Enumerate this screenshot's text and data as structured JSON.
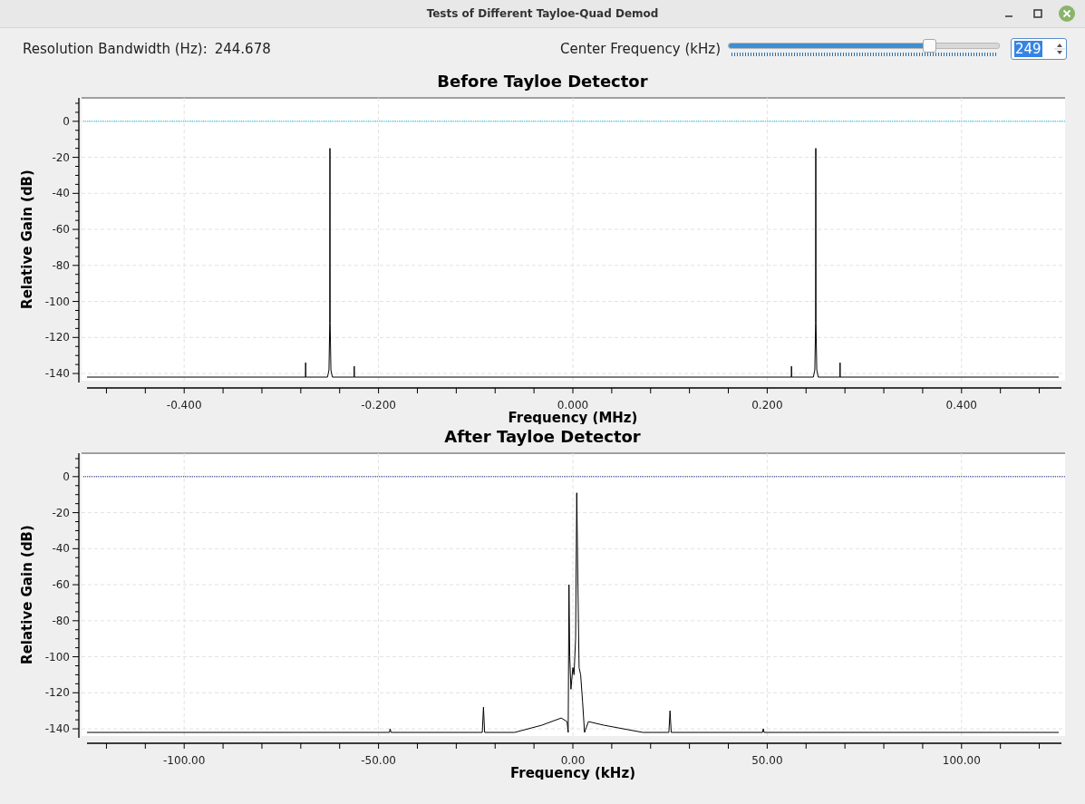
{
  "window": {
    "title": "Tests of Different Tayloe-Quad Demod"
  },
  "controls": {
    "resolution_label": "Resolution Bandwidth (Hz):",
    "resolution_value": "244.678",
    "center_label": "Center Frequency (kHz)",
    "center_slider": {
      "level": 0.74
    },
    "center_spinbox": {
      "value": "249"
    }
  },
  "plots": [
    {
      "chart_data": {
        "type": "line",
        "title": "Before Tayloe Detector",
        "xlabel": "Frequency (MHz)",
        "ylabel": "Relative Gain (dB)",
        "xlim": [
          -0.5,
          0.5
        ],
        "ylim": [
          -144,
          13
        ],
        "xticks": [
          {
            "value": -0.4,
            "label": "-0.400"
          },
          {
            "value": -0.2,
            "label": "-0.200"
          },
          {
            "value": 0,
            "label": "0.000"
          },
          {
            "value": 0.2,
            "label": "0.200"
          },
          {
            "value": 0.4,
            "label": "0.400"
          }
        ],
        "yticks": [
          0,
          -20,
          -40,
          -60,
          -80,
          -100,
          -120,
          -140
        ],
        "x": [
          -0.5,
          -0.2751,
          -0.275,
          -0.2749,
          -0.2525,
          -0.251,
          -0.2502,
          -0.25,
          -0.2498,
          -0.249,
          -0.2475,
          -0.2251,
          -0.225,
          -0.2249,
          0.2249,
          0.225,
          0.2251,
          0.2475,
          0.249,
          0.2498,
          0.25,
          0.2502,
          0.251,
          0.2525,
          0.2749,
          0.275,
          0.2751,
          0.5
        ],
        "series": [
          {
            "color": "#000000",
            "values": [
              -142,
              -142,
              -134,
              -142,
              -142,
              -138,
              -112,
              -15,
              -112,
              -138,
              -142,
              -142,
              -136,
              -142,
              -142,
              -136,
              -142,
              -142,
              -138,
              -112,
              -15,
              -112,
              -138,
              -142,
              -142,
              -134,
              -142,
              -142
            ]
          }
        ],
        "grid": true,
        "ref_lines": [
          {
            "axis": "y",
            "value": 0,
            "color": "#00b8d8"
          }
        ]
      }
    },
    {
      "chart_data": {
        "type": "line",
        "title": "After Tayloe Detector",
        "xlabel": "Frequency (kHz)",
        "ylabel": "Relative Gain (dB)",
        "xlim": [
          -125,
          125
        ],
        "ylim": [
          -144,
          13
        ],
        "xticks": [
          {
            "value": -100,
            "label": "-100.00"
          },
          {
            "value": -50,
            "label": "-50.00"
          },
          {
            "value": 0,
            "label": "0.00"
          },
          {
            "value": 50,
            "label": "50.00"
          },
          {
            "value": 100,
            "label": "100.00"
          }
        ],
        "yticks": [
          0,
          -20,
          -40,
          -60,
          -80,
          -100,
          -120,
          -140
        ],
        "x": [
          -125,
          -47.2,
          -47,
          -46.8,
          -23.3,
          -23,
          -22.7,
          -15,
          -8,
          -3,
          -1.5,
          -1.2,
          -1,
          -0.8,
          -0.5,
          0,
          0.3,
          0.7,
          1,
          1.3,
          1.6,
          2,
          2.5,
          3,
          4,
          8,
          18,
          24.7,
          25,
          25.3,
          48.8,
          49,
          49.2,
          125
        ],
        "series": [
          {
            "color": "#000000",
            "values": [
              -142,
              -142,
              -140,
              -142,
              -142,
              -128,
              -142,
              -142,
              -138,
              -134,
              -136,
              -142,
              -60,
              -100,
              -118,
              -106,
              -110,
              -90,
              -9,
              -60,
              -106,
              -110,
              -125,
              -142,
              -136,
              -138,
              -142,
              -142,
              -130,
              -142,
              -142,
              -140,
              -142,
              -142
            ]
          }
        ],
        "grid": true,
        "ref_lines": [
          {
            "axis": "y",
            "value": 0,
            "color": "#1a237e"
          }
        ]
      }
    }
  ]
}
